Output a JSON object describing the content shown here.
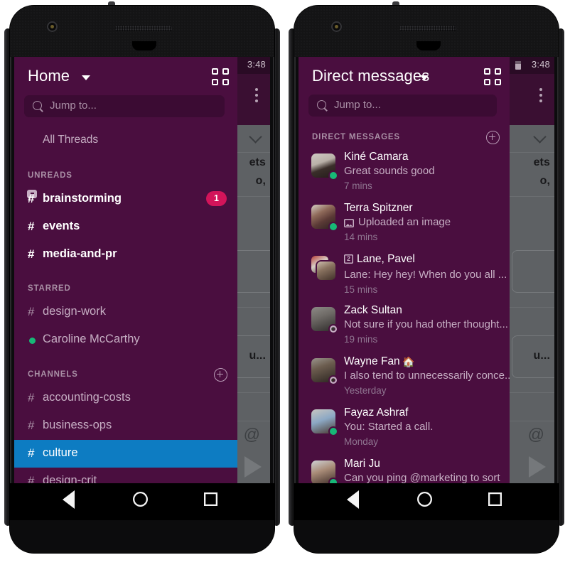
{
  "status_bar": {
    "time": "3:48"
  },
  "android_nav": {
    "back_label": "back-button",
    "home_label": "home-button",
    "recents_label": "recents-button"
  },
  "left_phone": {
    "drawer": {
      "title": "Home",
      "grid_icon": "grid-apps-icon",
      "search": {
        "placeholder": "Jump to...",
        "value": "",
        "icon": "search-icon"
      },
      "all_threads": {
        "label": "All Threads",
        "icon": "threads-icon"
      },
      "sections": [
        {
          "label": "UNREADS",
          "has_add": false,
          "items": [
            {
              "type": "channel",
              "name": "brainstorming",
              "unread": true,
              "badge": "1"
            },
            {
              "type": "channel",
              "name": "events",
              "unread": true,
              "badge": ""
            },
            {
              "type": "channel",
              "name": "media-and-pr",
              "unread": true,
              "badge": ""
            }
          ]
        },
        {
          "label": "STARRED",
          "has_add": false,
          "items": [
            {
              "type": "channel",
              "name": "design-work",
              "unread": false,
              "badge": ""
            },
            {
              "type": "dm",
              "name": "Caroline McCarthy",
              "presence": "online"
            }
          ]
        },
        {
          "label": "CHANNELS",
          "has_add": true,
          "add_icon": "plus-circle-icon",
          "items": [
            {
              "type": "channel",
              "name": "accounting-costs",
              "unread": false,
              "selected": false
            },
            {
              "type": "channel",
              "name": "business-ops",
              "unread": false,
              "selected": false
            },
            {
              "type": "channel",
              "name": "culture",
              "unread": false,
              "selected": true
            },
            {
              "type": "channel",
              "name": "design-crit",
              "unread": false,
              "selected": false
            }
          ]
        }
      ]
    },
    "background": {
      "truncated_lines": [
        "ets",
        "o,"
      ],
      "message_snippet": "u...",
      "mention_icon": "at-icon",
      "send_icon": "send-icon",
      "kebab_icon": "overflow-menu-icon",
      "chevron_icon": "chevron-down-icon"
    }
  },
  "right_phone": {
    "drawer": {
      "title": "Direct messages",
      "grid_icon": "grid-apps-icon",
      "search": {
        "placeholder": "Jump to...",
        "value": "",
        "icon": "search-icon"
      },
      "section_label": "DIRECT MESSAGES",
      "add_icon": "plus-circle-icon",
      "conversations": [
        {
          "name": "Kiné Camara",
          "preview": "Great sounds good",
          "time": "7 mins",
          "presence": "online",
          "avatar": "kine-camara-avatar",
          "kind": "single",
          "prefix_icon": ""
        },
        {
          "name": "Terra Spitzner",
          "preview": "Uploaded an image",
          "time": "14 mins",
          "presence": "online",
          "avatar": "terra-spitzner-avatar",
          "kind": "single",
          "prefix_icon": "image-icon"
        },
        {
          "name": "Lane, Pavel",
          "preview": "Lane: Hey hey! When do you all ...",
          "time": "15 mins",
          "presence": "none",
          "avatar": "group-avatar",
          "kind": "group",
          "prefix_icon": "group-count-icon",
          "group_count": "2"
        },
        {
          "name": "Zack Sultan",
          "preview": "Not sure if you had other thought...",
          "time": "19 mins",
          "presence": "away",
          "avatar": "zack-sultan-avatar",
          "kind": "single",
          "prefix_icon": ""
        },
        {
          "name": "Wayne Fan",
          "emoji": "🏠",
          "preview": "I also tend to unnecessarily conce...",
          "time": "Yesterday",
          "presence": "away",
          "avatar": "wayne-fan-avatar",
          "kind": "single",
          "prefix_icon": ""
        },
        {
          "name": "Fayaz Ashraf",
          "preview": "You: Started a call.",
          "time": "Monday",
          "presence": "online",
          "avatar": "fayaz-ashraf-avatar",
          "kind": "single",
          "prefix_icon": ""
        },
        {
          "name": "Mari Ju",
          "preview": "Can you ping @marketing to sort",
          "time": "",
          "presence": "online",
          "avatar": "mari-ju-avatar",
          "kind": "single",
          "prefix_icon": ""
        }
      ]
    },
    "background": {
      "truncated_lines": [
        "ets",
        "o,"
      ],
      "message_snippet": "u...",
      "mention_icon": "at-icon",
      "send_icon": "send-icon",
      "kebab_icon": "overflow-menu-icon",
      "chevron_icon": "chevron-down-icon"
    }
  },
  "colors": {
    "drawer_bg": "#4a0e3f",
    "search_bg": "#3b0b33",
    "selected_channel": "#0d7cc2",
    "badge": "#d2145a",
    "presence_online": "#17b877",
    "muted_text": "#c6aec3",
    "section_label": "#a98fa5",
    "scrim": "#5e6164"
  }
}
